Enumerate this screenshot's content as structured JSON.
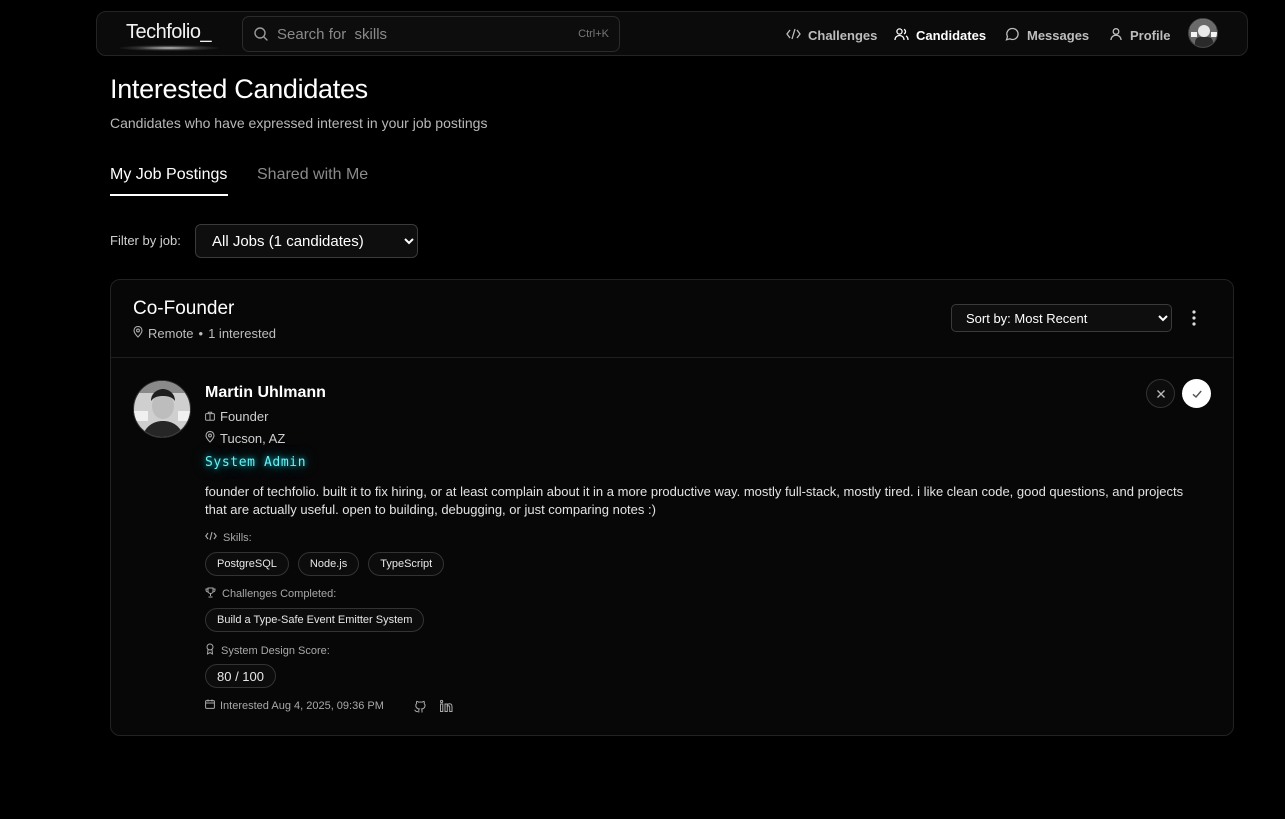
{
  "nav": {
    "logo": "Techfolio_",
    "search_placeholder": "Search for  skills",
    "search_shortcut": "Ctrl+K",
    "items": [
      {
        "label": "Challenges",
        "icon": "code-icon"
      },
      {
        "label": "Candidates",
        "icon": "users-icon",
        "active": true
      },
      {
        "label": "Messages",
        "icon": "message-icon"
      },
      {
        "label": "Profile",
        "icon": "user-icon"
      }
    ]
  },
  "header": {
    "title": "Interested Candidates",
    "subtitle": "Candidates who have expressed interest in your job postings"
  },
  "tabs": [
    {
      "label": "My Job Postings",
      "active": true
    },
    {
      "label": "Shared with Me",
      "active": false
    }
  ],
  "filter": {
    "label": "Filter by job:",
    "selected": "All Jobs (1 candidates)"
  },
  "job": {
    "title": "Co-Founder",
    "location": "Remote",
    "separator": "•",
    "interested": "1 interested",
    "sort_selected": "Sort by: Most Recent"
  },
  "candidate": {
    "name": "Martin Uhlmann",
    "role": "Founder",
    "location": "Tucson, AZ",
    "badge": "System Admin",
    "bio": "founder of techfolio. built it to fix hiring, or at least complain about it in a more productive way. mostly full-stack, mostly tired. i like clean code, good questions, and projects that are actually useful. open to building, debugging, or just comparing notes :)",
    "skills_label": "Skills:",
    "skills": [
      "PostgreSQL",
      "Node.js",
      "TypeScript"
    ],
    "challenges_label": "Challenges Completed:",
    "challenges": [
      "Build a Type-Safe Event Emitter System"
    ],
    "score_label": "System Design Score:",
    "score": "80 / 100",
    "interested_at": "Interested Aug 4, 2025, 09:36 PM"
  },
  "colors": {
    "background": "#000000",
    "badge_glow": "#6ef0f5",
    "accent_white": "#ffffff"
  }
}
